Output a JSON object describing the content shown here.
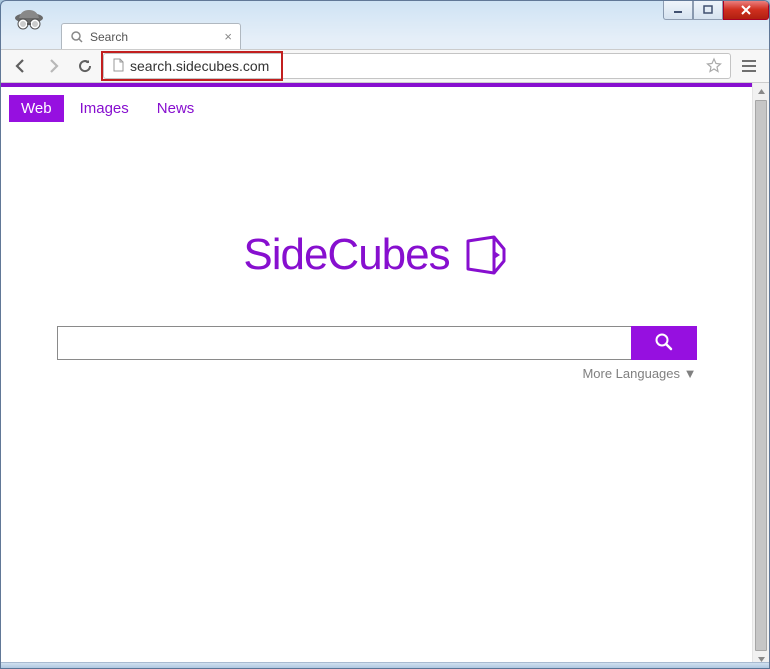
{
  "window": {
    "controls": {
      "min": "minimize",
      "max": "maximize",
      "close": "close"
    }
  },
  "tab": {
    "title": "Search"
  },
  "address": {
    "url": "search.sidecubes.com"
  },
  "page": {
    "nav": {
      "web": "Web",
      "images": "Images",
      "news": "News"
    },
    "brand": "SideCubes",
    "search_placeholder": "",
    "more_languages": "More Languages ▼"
  },
  "colors": {
    "brand_purple": "#870fcf",
    "highlight_red": "#c21f1f"
  }
}
